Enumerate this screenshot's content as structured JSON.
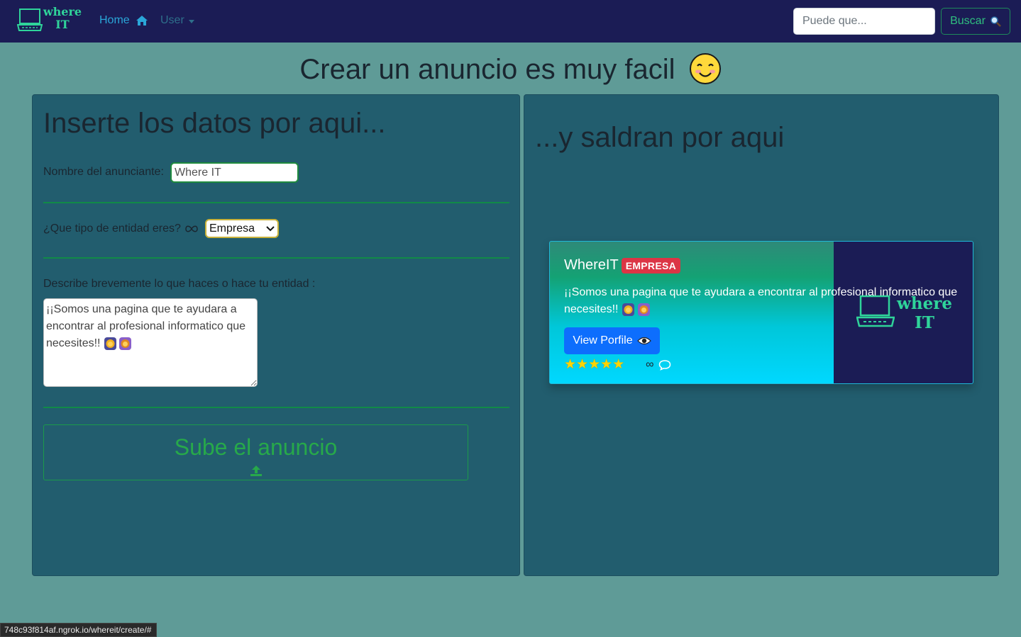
{
  "navbar": {
    "brand_line1": "where",
    "brand_line2": "IT",
    "home_label": "Home",
    "user_label": "User",
    "search_placeholder": "Puede que...",
    "search_button": "Buscar"
  },
  "page": {
    "title": "Crear un anuncio es muy facil"
  },
  "form": {
    "heading": "Inserte los datos por aqui...",
    "name_label": "Nombre del anunciante:",
    "name_value": "Where IT",
    "type_label": "¿Que tipo de entidad eres?",
    "type_selected": "Empresa",
    "desc_label": "Describe brevemente lo que haces o hace tu entidad :",
    "desc_value": "¡¡Somos una pagina que te ayudara a encontrar al profesional informatico que necesites!!",
    "submit_label": "Sube el anuncio"
  },
  "preview": {
    "heading": "...y saldran por aqui",
    "card_title": "WhereIT",
    "card_badge": "EMPRESA",
    "card_text": "¡¡Somos una pagina que te ayudara a encontrar al profesional informatico que necesites!!",
    "card_button": "View Porfile",
    "rating_stars": 5,
    "stars_text": "★★★★★",
    "comment_count": "∞",
    "image_brand_line1": "where",
    "image_brand_line2": "IT"
  },
  "status_bar": {
    "url": "748c93f814af.ngrok.io/whereit/create/#"
  },
  "colors": {
    "navbar_bg": "#1b1c55",
    "page_bg": "#5f9b97",
    "panel_bg": "#225d6e",
    "accent_green": "#2fd49a",
    "badge_red": "#dc3545",
    "button_blue": "#0d6efd"
  },
  "icons": [
    "laptop-logo-icon",
    "home-icon",
    "search-icon",
    "smiling-face-icon",
    "infinity-icon",
    "lion-emoji-icon",
    "upload-icon",
    "eye-icon",
    "star-icon",
    "comment-icon"
  ]
}
